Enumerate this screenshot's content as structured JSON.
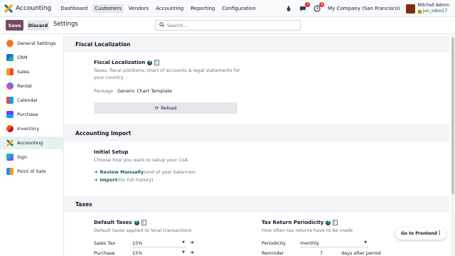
{
  "topbar": {
    "app_name": "Accounting",
    "menu": [
      "Dashboard",
      "Customers",
      "Vendors",
      "Accounting",
      "Reporting",
      "Configuration"
    ],
    "active_menu": "Customers",
    "chat_badge": "7",
    "activity_badge": "8",
    "company": "My Company (San Francisco)",
    "user_name": "Mitchell Admin",
    "user_db": "jun_odoo17"
  },
  "control": {
    "save_label": "Save",
    "discard_label": "Discard",
    "title": "Settings",
    "search_placeholder": "Search..."
  },
  "sidebar": {
    "items": [
      {
        "label": "General Settings",
        "icon": "general-settings-icon",
        "color": "#f97316"
      },
      {
        "label": "CRM",
        "icon": "crm-icon",
        "color": "#2563eb"
      },
      {
        "label": "Sales",
        "icon": "sales-icon",
        "color": "#f59e0b"
      },
      {
        "label": "Rental",
        "icon": "rental-icon",
        "color": "#ec4899"
      },
      {
        "label": "Calendar",
        "icon": "calendar-icon",
        "color": "#0ea5e9"
      },
      {
        "label": "Purchase",
        "icon": "purchase-icon",
        "color": "#7c3aed"
      },
      {
        "label": "Inventory",
        "icon": "inventory-icon",
        "color": "#ea580c"
      },
      {
        "label": "Accounting",
        "icon": "accounting-icon",
        "color": "#0f766e"
      },
      {
        "label": "Sign",
        "icon": "sign-icon",
        "color": "#14b8a6"
      },
      {
        "label": "Point of Sale",
        "icon": "point-of-sale-icon",
        "color": "#3b82f6"
      }
    ],
    "active": "Accounting"
  },
  "sections": {
    "fiscal": {
      "header": "Fiscal Localization",
      "title": "Fiscal Localization",
      "desc1": "Taxes, fiscal positions, chart of accounts & legal statements for",
      "desc2": "your country",
      "package_label": "Package",
      "package_value": "Generic Chart Template",
      "reload_label": "Reload"
    },
    "import": {
      "header": "Accounting Import",
      "title": "Initial Setup",
      "desc": "Choose how you want to setup your CoA",
      "link1": "Review Manually",
      "link1_note": "(end of year balances)",
      "link2": "Import",
      "link2_note": "(for full history)"
    },
    "taxes": {
      "header": "Taxes",
      "default_title": "Default Taxes",
      "default_desc": "Default taxes applied to local transactions",
      "sales_tax_label": "Sales Tax",
      "sales_tax_value": "15%",
      "purchase_tax_label": "Purchase",
      "purchase_tax_value": "15%",
      "periodicity_title": "Tax Return Periodicity",
      "periodicity_desc": "How often tax returns have to be made",
      "periodicity_label": "Periodicity",
      "periodicity_value": "monthly",
      "reminder_label": "Reminder",
      "reminder_value": "7",
      "reminder_suffix": "days after period"
    }
  },
  "floating": {
    "go_frontend": "Go to Frontend"
  },
  "colors": {
    "brand": "#714b67",
    "accent": "#0f5f5c"
  }
}
